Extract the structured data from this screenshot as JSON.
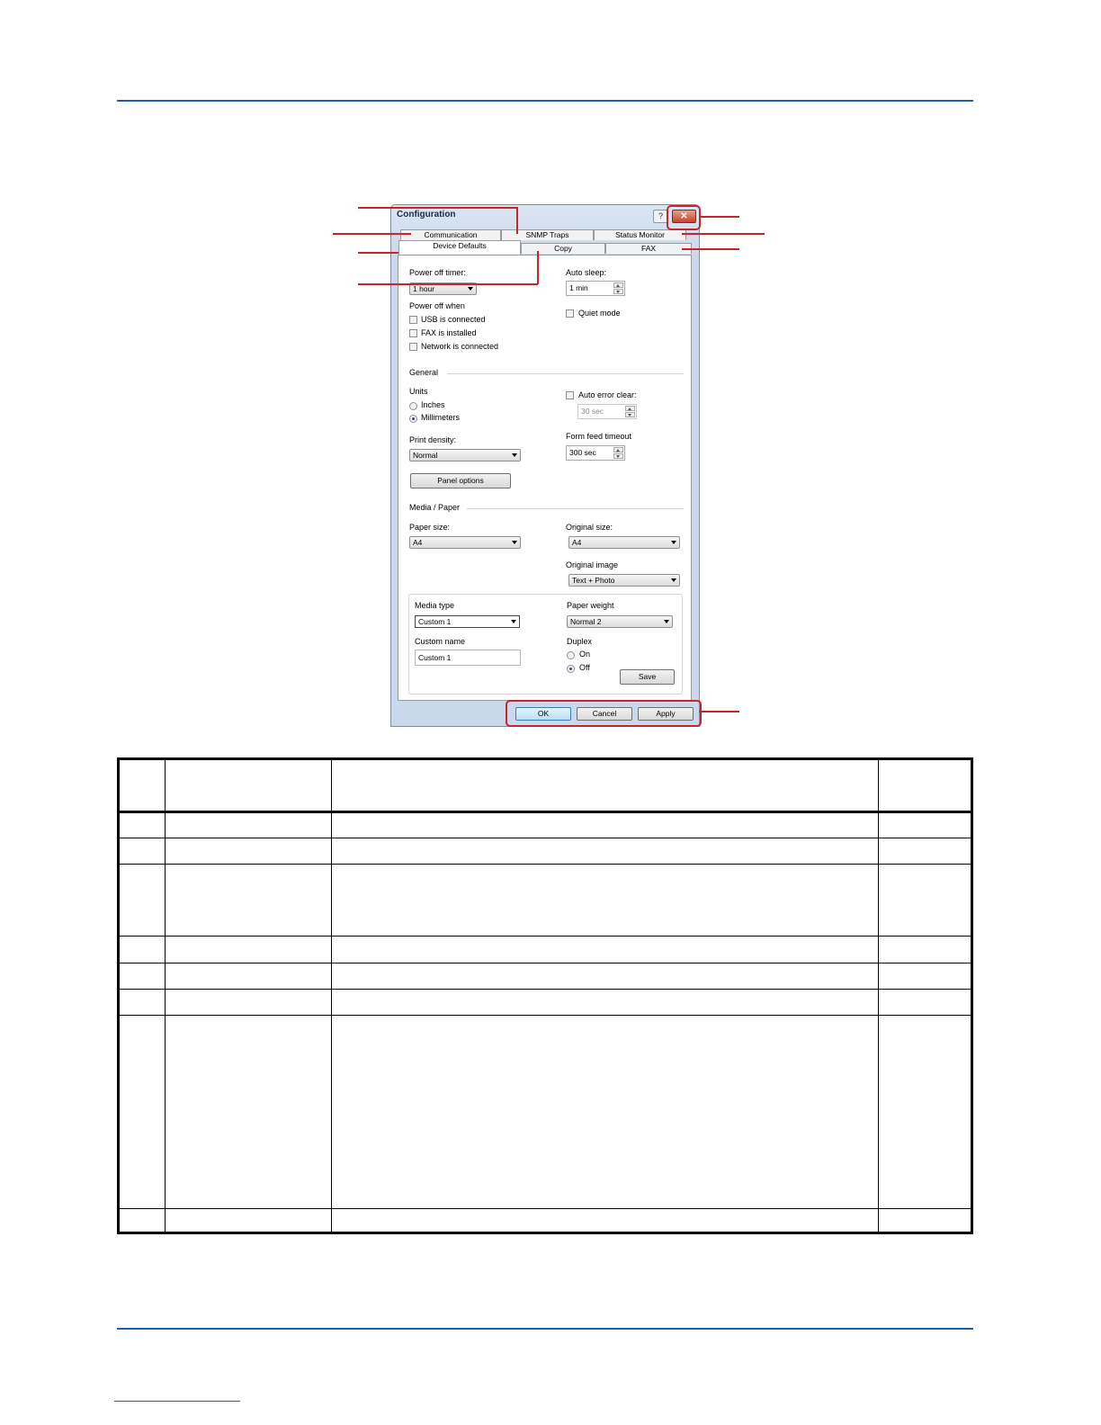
{
  "dialog": {
    "title": "Configuration",
    "help_glyph": "?",
    "close_glyph": "✕",
    "tabs_back": [
      "Communication",
      "SNMP Traps",
      "Status Monitor"
    ],
    "tabs_front": [
      "Device Defaults",
      "Copy",
      "FAX"
    ],
    "power_off_timer": {
      "label": "Power off timer:",
      "value": "1 hour"
    },
    "auto_sleep": {
      "label": "Auto sleep:",
      "value": "1 min"
    },
    "power_off_when": {
      "label": "Power off when",
      "options": [
        "USB is connected",
        "FAX is installed",
        "Network is connected"
      ]
    },
    "quiet_mode": "Quiet mode",
    "general": {
      "heading": "General",
      "units_label": "Units",
      "units_options": [
        "Inches",
        "Millimeters"
      ],
      "units_selected": "Millimeters",
      "auto_error_clear": {
        "label": "Auto error clear:",
        "value": "30 sec"
      },
      "print_density": {
        "label": "Print density:",
        "value": "Normal"
      },
      "form_feed_timeout": {
        "label": "Form feed timeout",
        "value": "300 sec"
      },
      "panel_options_button": "Panel options"
    },
    "media_paper": {
      "heading": "Media / Paper",
      "paper_size": {
        "label": "Paper size:",
        "value": "A4"
      },
      "original_size": {
        "label": "Original size:",
        "value": "A4"
      },
      "original_image": {
        "label": "Original image",
        "value": "Text + Photo"
      },
      "media_type": {
        "label": "Media type",
        "value": "Custom 1"
      },
      "paper_weight": {
        "label": "Paper weight",
        "value": "Normal 2"
      },
      "custom_name": {
        "label": "Custom name",
        "value": "Custom 1"
      },
      "duplex": {
        "label": "Duplex",
        "options": [
          "On",
          "Off"
        ],
        "selected": "Off"
      },
      "save_button": "Save"
    },
    "buttons": {
      "ok": "OK",
      "cancel": "Cancel",
      "apply": "Apply"
    }
  },
  "colors": {
    "rule": "#1f5fa8",
    "callout": "#c8242b"
  }
}
